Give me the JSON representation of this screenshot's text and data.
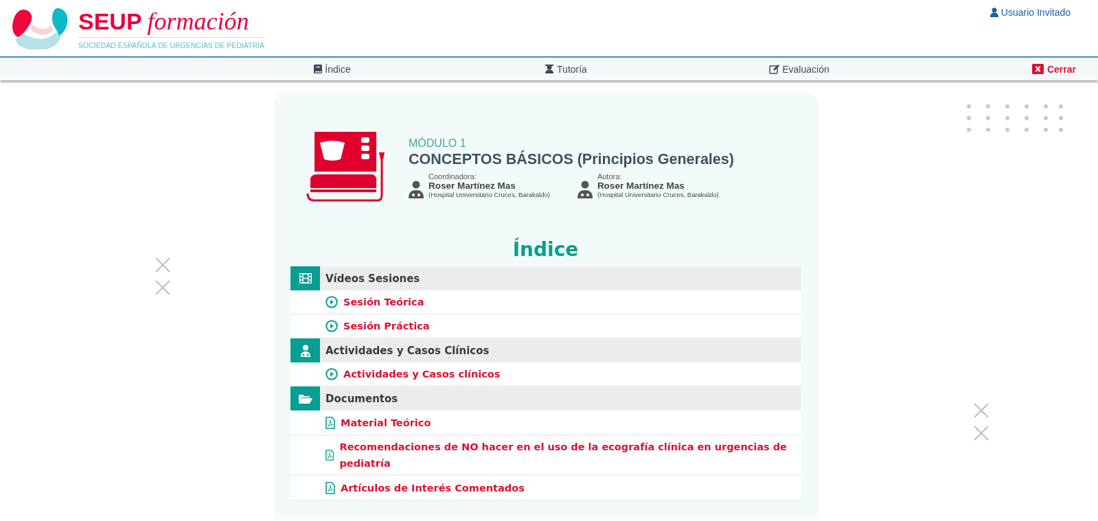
{
  "header": {
    "logo_title": "SEUP",
    "logo_script": "formación",
    "logo_subtitle": "SOCIEDAD ESPAÑOLA DE URGENCIAS DE PEDIATRIA",
    "user_link": "Usuario Invitado"
  },
  "nav": {
    "items": [
      {
        "label": "Índice",
        "kind": "book"
      },
      {
        "label": "Tutoría",
        "kind": "teacher"
      },
      {
        "label": "Evaluación",
        "kind": "edit"
      }
    ],
    "close": "Cerrar"
  },
  "module": {
    "eyebrow": "MÓDULO 1",
    "title": "CONCEPTOS BÁSICOS (Principios Generales)",
    "people": [
      {
        "role": "Coordinadora:",
        "name": "Roser Martínez Mas",
        "affiliation": "(Hospital Universitario Cruces, Barakaldo)"
      },
      {
        "role": "Autora:",
        "name": "Roser Martínez Mas",
        "affiliation": "(Hospital Universitario Cruces, Barakaldo)"
      }
    ]
  },
  "index": {
    "title": "Índice",
    "sections": [
      {
        "label": "Vídeos Sesiones",
        "kind": "film",
        "items": [
          {
            "label": "Sesión Teórica",
            "kind": "video"
          },
          {
            "label": "Sesión Práctica",
            "kind": "video"
          }
        ]
      },
      {
        "label": "Actividades y Casos Clínicos",
        "kind": "doctor",
        "items": [
          {
            "label": "Actividades y Casos clínicos",
            "kind": "video"
          }
        ]
      },
      {
        "label": "Documentos",
        "kind": "folder",
        "items": [
          {
            "label": "Material Teórico",
            "kind": "pdf"
          },
          {
            "label": "Recomendaciones de NO hacer en el uso de la ecografía clínica en urgencias de pediatría",
            "kind": "pdf"
          },
          {
            "label": "Artículos de Interés Comentados",
            "kind": "pdf"
          }
        ]
      }
    ]
  }
}
